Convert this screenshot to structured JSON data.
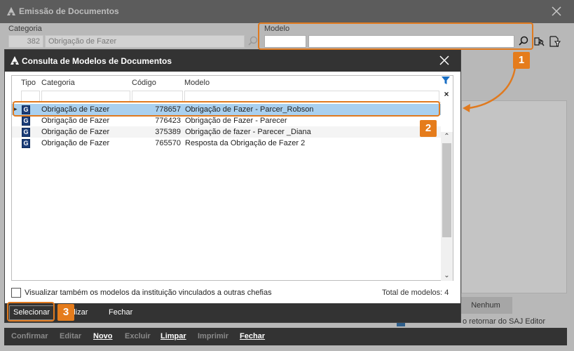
{
  "outer_window": {
    "title": "Emissão de Documentos",
    "categoria_label": "Categoria",
    "categoria_code": "382",
    "categoria_name": "Obrigação de Fazer",
    "modelo_label": "Modelo",
    "modelo_code": "",
    "modelo_name": "",
    "nenhum_button": "Nenhum",
    "saj_checkbox_label": "o retornar do SAJ Editor",
    "footer_buttons": [
      {
        "label": "Confirmar",
        "enabled": false
      },
      {
        "label": "Editar",
        "enabled": false
      },
      {
        "label": "Novo",
        "enabled": true
      },
      {
        "label": "Excluir",
        "enabled": false
      },
      {
        "label": "Limpar",
        "enabled": true
      },
      {
        "label": "Imprimir",
        "enabled": false
      },
      {
        "label": "Fechar",
        "enabled": true
      }
    ]
  },
  "modal": {
    "title": "Consulta de Modelos de Documentos",
    "columns": {
      "tipo": "Tipo",
      "categoria": "Categoria",
      "codigo": "Código",
      "modelo": "Modelo"
    },
    "rows": [
      {
        "tipo_icon": "G",
        "categoria": "Obrigação de Fazer",
        "codigo": "778657",
        "modelo": "Obrigação de Fazer - Parcer_Robson",
        "selected": true
      },
      {
        "tipo_icon": "G",
        "categoria": "Obrigação de Fazer",
        "codigo": "776423",
        "modelo": "Obrigação de Fazer - Parecer",
        "selected": false
      },
      {
        "tipo_icon": "G",
        "categoria": "Obrigação de Fazer",
        "codigo": "375389",
        "modelo": "Obrigação de fazer - Parecer _Diana",
        "selected": false
      },
      {
        "tipo_icon": "G",
        "categoria": "Obrigação de Fazer",
        "codigo": "765570",
        "modelo": "Resposta da Obrigação de Fazer 2",
        "selected": false
      }
    ],
    "checkbox_label": "Visualizar também os modelos da instituição vinculados a outras chefias",
    "checkbox_checked": false,
    "total_label": "Total de modelos: 4",
    "footer": {
      "selecionar": "Selecionar",
      "visualizar": "Visualizar",
      "visualizar_visible": "ualizar",
      "fechar": "Fechar"
    }
  },
  "annotations": {
    "badge_1": "1",
    "badge_2": "2",
    "badge_3": "3",
    "color": "#e57c1c"
  },
  "colors": {
    "selected_row": "#a9d0ef",
    "dark_bar": "#333333",
    "tipo_icon_bg": "#1b3d78"
  }
}
